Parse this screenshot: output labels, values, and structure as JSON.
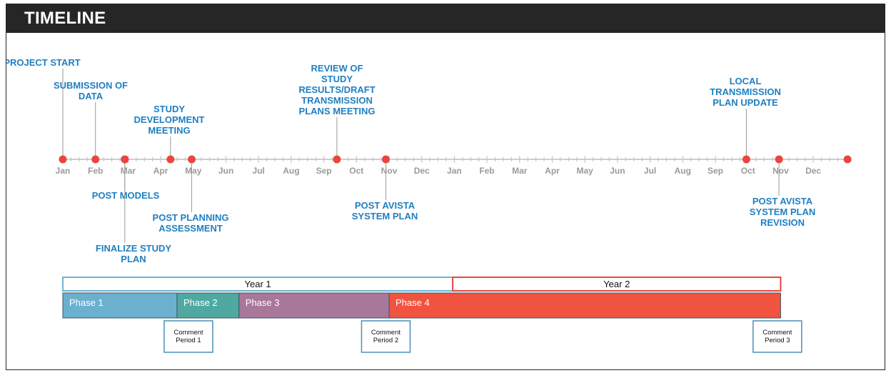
{
  "header": {
    "title": "TIMELINE"
  },
  "months": [
    "Jan",
    "Feb",
    "Mar",
    "Apr",
    "May",
    "Jun",
    "Jul",
    "Aug",
    "Sep",
    "Oct",
    "Nov",
    "Dec",
    "Jan",
    "Feb",
    "Mar",
    "Apr",
    "May",
    "Jun",
    "Jul",
    "Aug",
    "Sep",
    "Oct",
    "Nov",
    "Dec"
  ],
  "events": [
    {
      "pos": 0.0,
      "side": "above",
      "lines": [
        "PROJECT START"
      ],
      "color": "#e8473b"
    },
    {
      "pos": 1.0,
      "side": "above",
      "lines": [
        "SUBMISSION OF",
        "DATA"
      ],
      "color": "#e8473b"
    },
    {
      "pos": 1.9,
      "side": "below",
      "lines": [
        "POST MODELS"
      ],
      "color": "#e8473b"
    },
    {
      "pos": 1.9,
      "side": "below",
      "lines": [
        "FINALIZE STUDY",
        "PLAN"
      ],
      "color": "#e8473b"
    },
    {
      "pos": 3.3,
      "side": "above",
      "lines": [
        "STUDY",
        "DEVELOPMENT",
        "MEETING"
      ],
      "color": "#e8473b"
    },
    {
      "pos": 3.95,
      "side": "below",
      "lines": [
        "POST PLANNING",
        "ASSESSMENT"
      ],
      "color": "#e8473b"
    },
    {
      "pos": 8.4,
      "side": "above",
      "lines": [
        "REVIEW OF",
        "STUDY",
        "RESULTS/DRAFT",
        "TRANSMISSION",
        "PLANS MEETING"
      ],
      "color": "#e8473b"
    },
    {
      "pos": 9.9,
      "side": "below",
      "lines": [
        "POST AVISTA",
        "SYSTEM PLAN"
      ],
      "color": "#e8473b"
    },
    {
      "pos": 20.95,
      "side": "above",
      "lines": [
        "LOCAL",
        "TRANSMISSION",
        "PLAN UPDATE"
      ],
      "color": "#e8473b"
    },
    {
      "pos": 21.95,
      "side": "below",
      "lines": [
        "POST AVISTA",
        "SYSTEM PLAN",
        "REVISION"
      ],
      "color": "#e8473b"
    },
    {
      "pos": 24.05,
      "side": "none",
      "lines": [],
      "color": "#e8473b"
    }
  ],
  "years": [
    {
      "label": "Year 1",
      "start": 0.0,
      "end": 11.95,
      "border": "#6fb3d3"
    },
    {
      "label": "Year 2",
      "start": 11.95,
      "end": 22.0,
      "border": "#e8473b"
    }
  ],
  "phases": [
    {
      "label": "Phase 1",
      "start": 0.0,
      "end": 3.5,
      "color": "#6cb0cf"
    },
    {
      "label": "Phase 2",
      "start": 3.5,
      "end": 5.4,
      "color": "#4fa9a0"
    },
    {
      "label": "Phase 3",
      "start": 5.4,
      "end": 10.0,
      "color": "#a8779a"
    },
    {
      "label": "Phase 4",
      "start": 10.0,
      "end": 22.0,
      "color": "#f05340"
    }
  ],
  "comments": [
    {
      "lines": [
        "Comment",
        "Period 1"
      ],
      "pos": 3.85
    },
    {
      "lines": [
        "Comment",
        "Period 2"
      ],
      "pos": 9.9
    },
    {
      "lines": [
        "Comment",
        "Period 3"
      ],
      "pos": 21.9
    }
  ],
  "colors": {
    "event_text": "#1f7fc1",
    "axis": "#bfbfbf",
    "month_text": "#9a9a9a",
    "marker": "#e8473b"
  }
}
